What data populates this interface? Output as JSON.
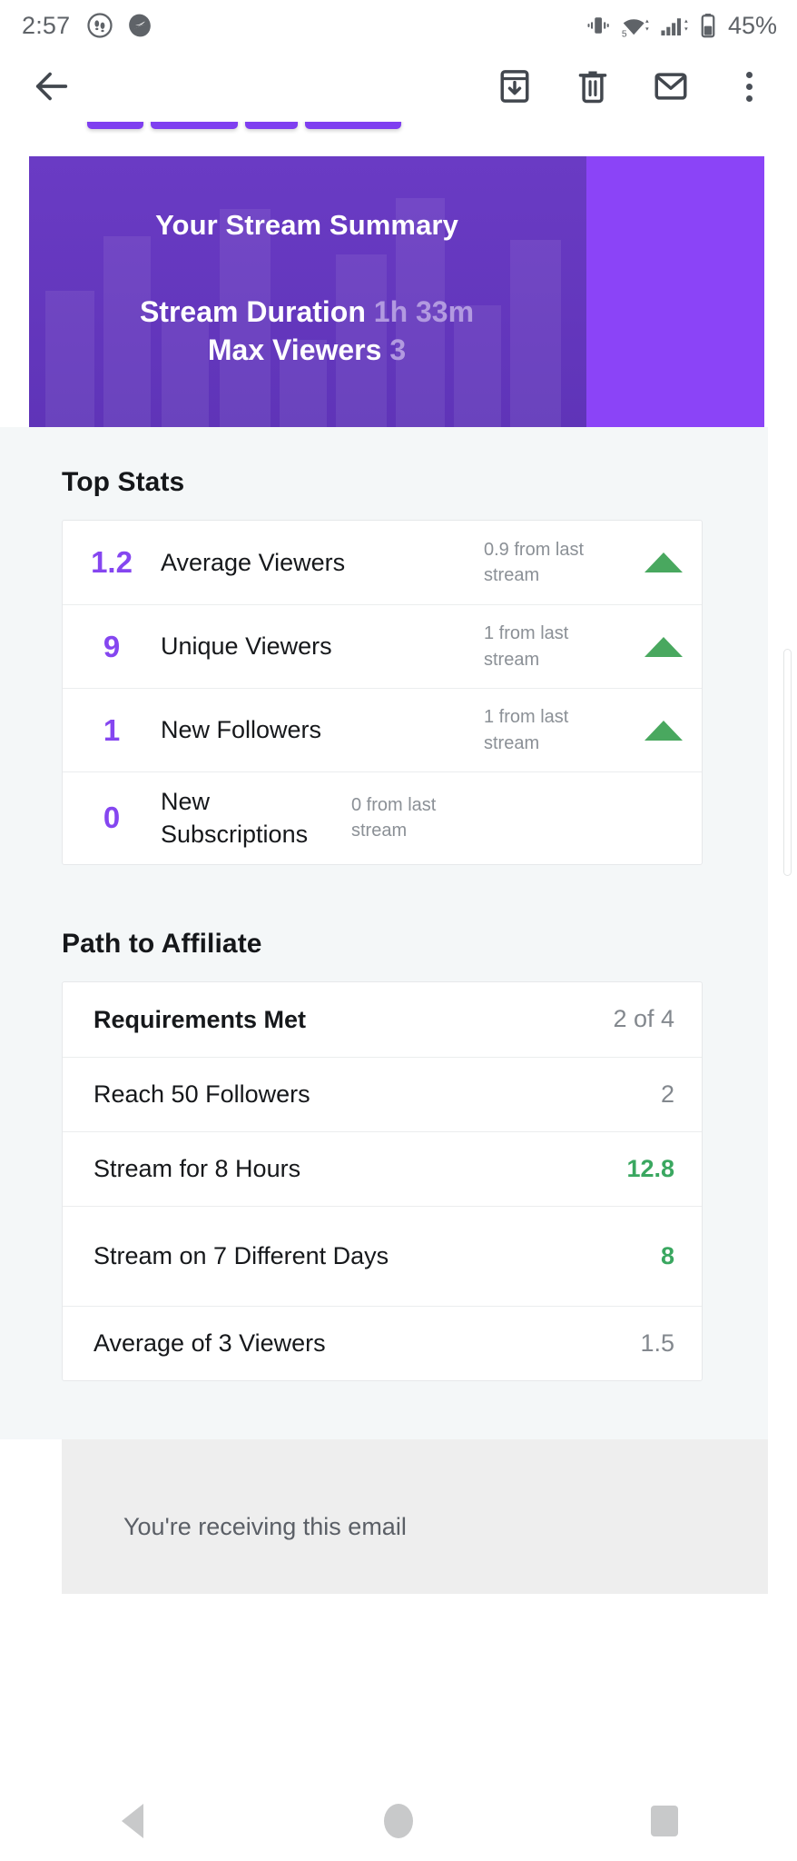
{
  "status_bar": {
    "time": "2:57",
    "left_icons": [
      "footprints-circle-icon",
      "shield-swirl-icon"
    ],
    "right_icons": [
      "vibrate-icon",
      "wifi-5g-icon",
      "cellular-signal-icon",
      "battery-icon"
    ],
    "battery_percent": "45%"
  },
  "toolbar": {
    "back_label": "back-arrow",
    "actions": [
      "archive-icon",
      "delete-icon",
      "mark-unread-icon",
      "overflow-menu-icon"
    ]
  },
  "hero": {
    "title": "Your Stream Summary",
    "duration_label": "Stream Duration",
    "duration_value": "1h 33m",
    "viewers_label": "Max Viewers",
    "viewers_value": "3",
    "bg_color": "#5f34b8",
    "accent_color": "#8b44f7",
    "value_color": "#b29ae0"
  },
  "top_stats": {
    "title": "Top Stats",
    "rows": [
      {
        "value": "1.2",
        "label": "Average Viewers",
        "delta": "0.9 from last stream",
        "trend": "up"
      },
      {
        "value": "9",
        "label": "Unique Viewers",
        "delta": "1 from last stream",
        "trend": "up"
      },
      {
        "value": "1",
        "label": "New Followers",
        "delta": "1 from last stream",
        "trend": "up"
      },
      {
        "value": "0",
        "label": "New Subscriptions",
        "delta": "0 from last stream",
        "trend": "none"
      }
    ],
    "value_color": "#8546f0",
    "trend_color": "#49a85f"
  },
  "affiliate": {
    "title": "Path to Affiliate",
    "summary_label": "Requirements Met",
    "summary_value": "2 of 4",
    "rows": [
      {
        "label": "Reach 50 Followers",
        "value": "2",
        "met": false
      },
      {
        "label": "Stream for 8 Hours",
        "value": "12.8",
        "met": true
      },
      {
        "label": "Stream on 7 Different Days",
        "value": "8",
        "met": true
      },
      {
        "label": "Average of 3 Viewers",
        "value": "1.5",
        "met": false
      }
    ],
    "met_color": "#3aa760",
    "unmet_color": "#83888e"
  },
  "footer": {
    "text": "You're receiving this email"
  },
  "nav_bar": {
    "items": [
      "back-button",
      "home-button",
      "recents-button"
    ]
  }
}
